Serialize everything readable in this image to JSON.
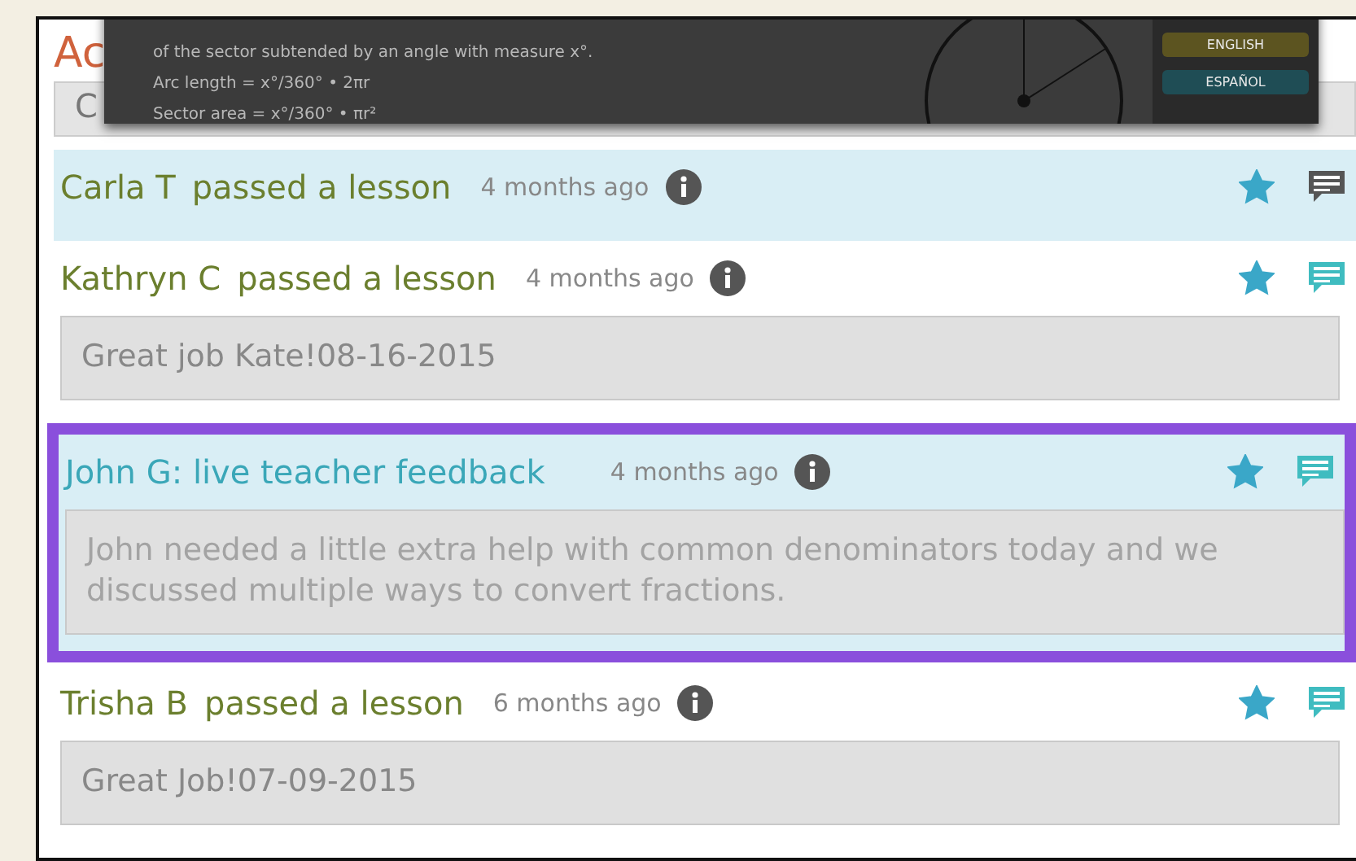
{
  "page": {
    "title": "Ac"
  },
  "hidden_row": {
    "text": "C"
  },
  "overlay": {
    "lines": [
      "of the sector subtended by an angle with measure x°.",
      "Arc length = x°/360° • 2πr",
      "Sector area = x°/360° • πr²"
    ],
    "buttons": [
      "ENGLISH",
      "ESPAÑOL"
    ]
  },
  "activities": [
    {
      "kind": "lesson",
      "name": "Carla T",
      "action": "passed a lesson",
      "time": "4 months ago",
      "starred": true,
      "has_comment": false,
      "selected": false,
      "highlighted": true
    },
    {
      "kind": "lesson",
      "name": "Kathryn C",
      "action": "passed a lesson",
      "time": "4 months ago",
      "starred": true,
      "has_comment": true,
      "selected": false,
      "highlighted": false,
      "comment": "Great job Kate!08-16-2015"
    },
    {
      "kind": "feedback",
      "name": "John G: live teacher feedback",
      "time": "4 months ago",
      "starred": true,
      "has_comment": true,
      "selected": true,
      "highlighted": true,
      "comment": "John needed a little extra help with common denominators today and we discussed multiple ways to convert fractions."
    },
    {
      "kind": "lesson",
      "name": "Trisha B",
      "action": "passed a lesson",
      "time": "6 months ago",
      "starred": true,
      "has_comment": true,
      "selected": false,
      "highlighted": false,
      "comment": "Great Job!07-09-2015"
    }
  ]
}
